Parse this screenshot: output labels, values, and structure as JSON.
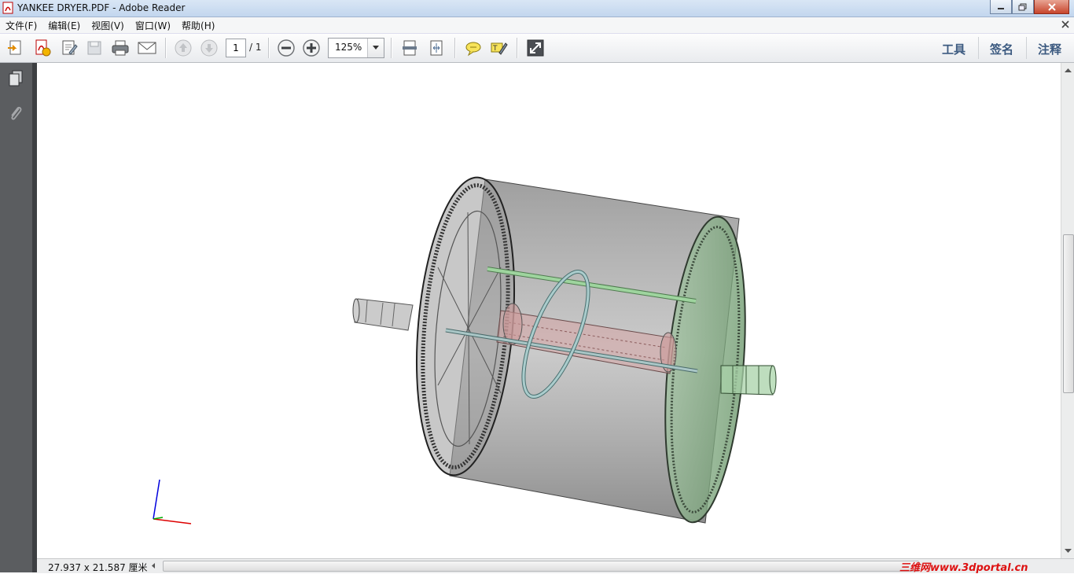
{
  "window": {
    "title": "YANKEE DRYER.PDF - Adobe Reader"
  },
  "menu": [
    {
      "label": "文件(F)"
    },
    {
      "label": "编辑(E)"
    },
    {
      "label": "视图(V)"
    },
    {
      "label": "窗口(W)"
    },
    {
      "label": "帮助(H)"
    }
  ],
  "toolbar": {
    "page_current": "1",
    "page_total": "/ 1",
    "zoom": "125%",
    "tabs": {
      "tools": "工具",
      "sign": "签名",
      "comment": "注释"
    }
  },
  "status": {
    "page_size": "27.937 x 21.587 厘米",
    "watermark": "三维网www.3dportal.cn"
  },
  "colors": {
    "accent": "#3c5a80",
    "drum": "#8a8a8a",
    "shaft_green": "#7fbf7f",
    "shaft_pink": "#d8a8a8"
  }
}
